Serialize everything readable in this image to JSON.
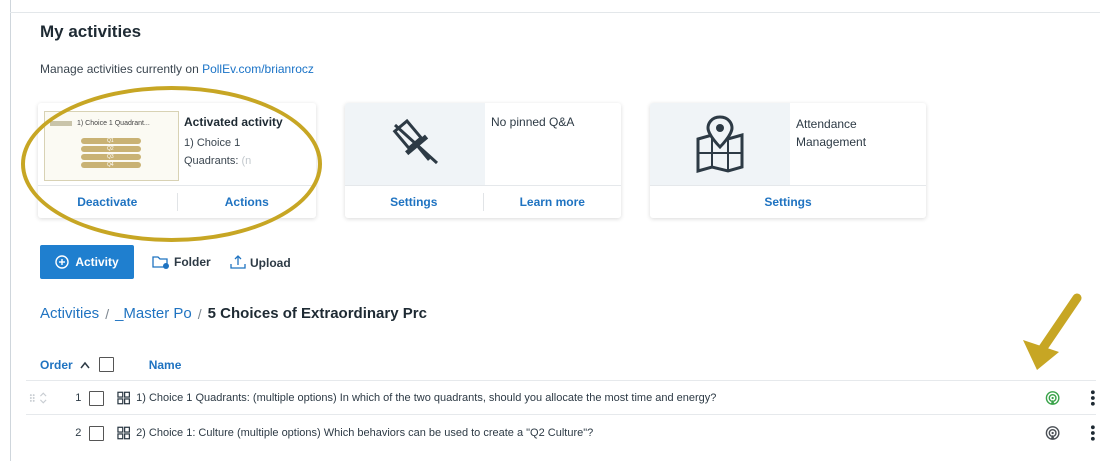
{
  "page": {
    "title": "My activities",
    "manage_prefix": "Manage activities currently on ",
    "manage_link": "PollEv.com/brianrocz"
  },
  "cards": {
    "activated": {
      "thumb_title": "1) Choice 1 Quadrant...",
      "thumb_rows": [
        "Q1",
        "Q2",
        "Q3",
        "Q4"
      ],
      "title": "Activated activity",
      "line1": "1) Choice 1",
      "line2": "Quadrants:",
      "line2_faded": "(n",
      "deactivate": "Deactivate",
      "actions": "Actions"
    },
    "qa": {
      "text": "No pinned Q&A",
      "settings": "Settings",
      "learn_more": "Learn more"
    },
    "attendance": {
      "line1": "Attendance",
      "line2": "Management",
      "settings": "Settings"
    }
  },
  "toolbar": {
    "activity": "Activity",
    "folder": "Folder",
    "upload": "Upload"
  },
  "breadcrumb": {
    "root": "Activities",
    "parent": "_Master Po",
    "current": "5 Choices of Extraordinary Prc"
  },
  "table": {
    "order_label": "Order",
    "name_label": "Name",
    "rows": [
      {
        "order": "1",
        "name": "1) Choice 1 Quadrants: (multiple options) In which of the two quadrants, should you allocate the most time and energy?",
        "active": true
      },
      {
        "order": "2",
        "name": "2) Choice 1: Culture (multiple options) Which behaviors can be used to create a \"Q2 Culture\"?",
        "active": false
      }
    ]
  },
  "colors": {
    "accent": "#1f7fcf",
    "highlight": "#c7a624",
    "active_icon": "#3aa34a",
    "inactive_icon": "#4a4f55"
  }
}
